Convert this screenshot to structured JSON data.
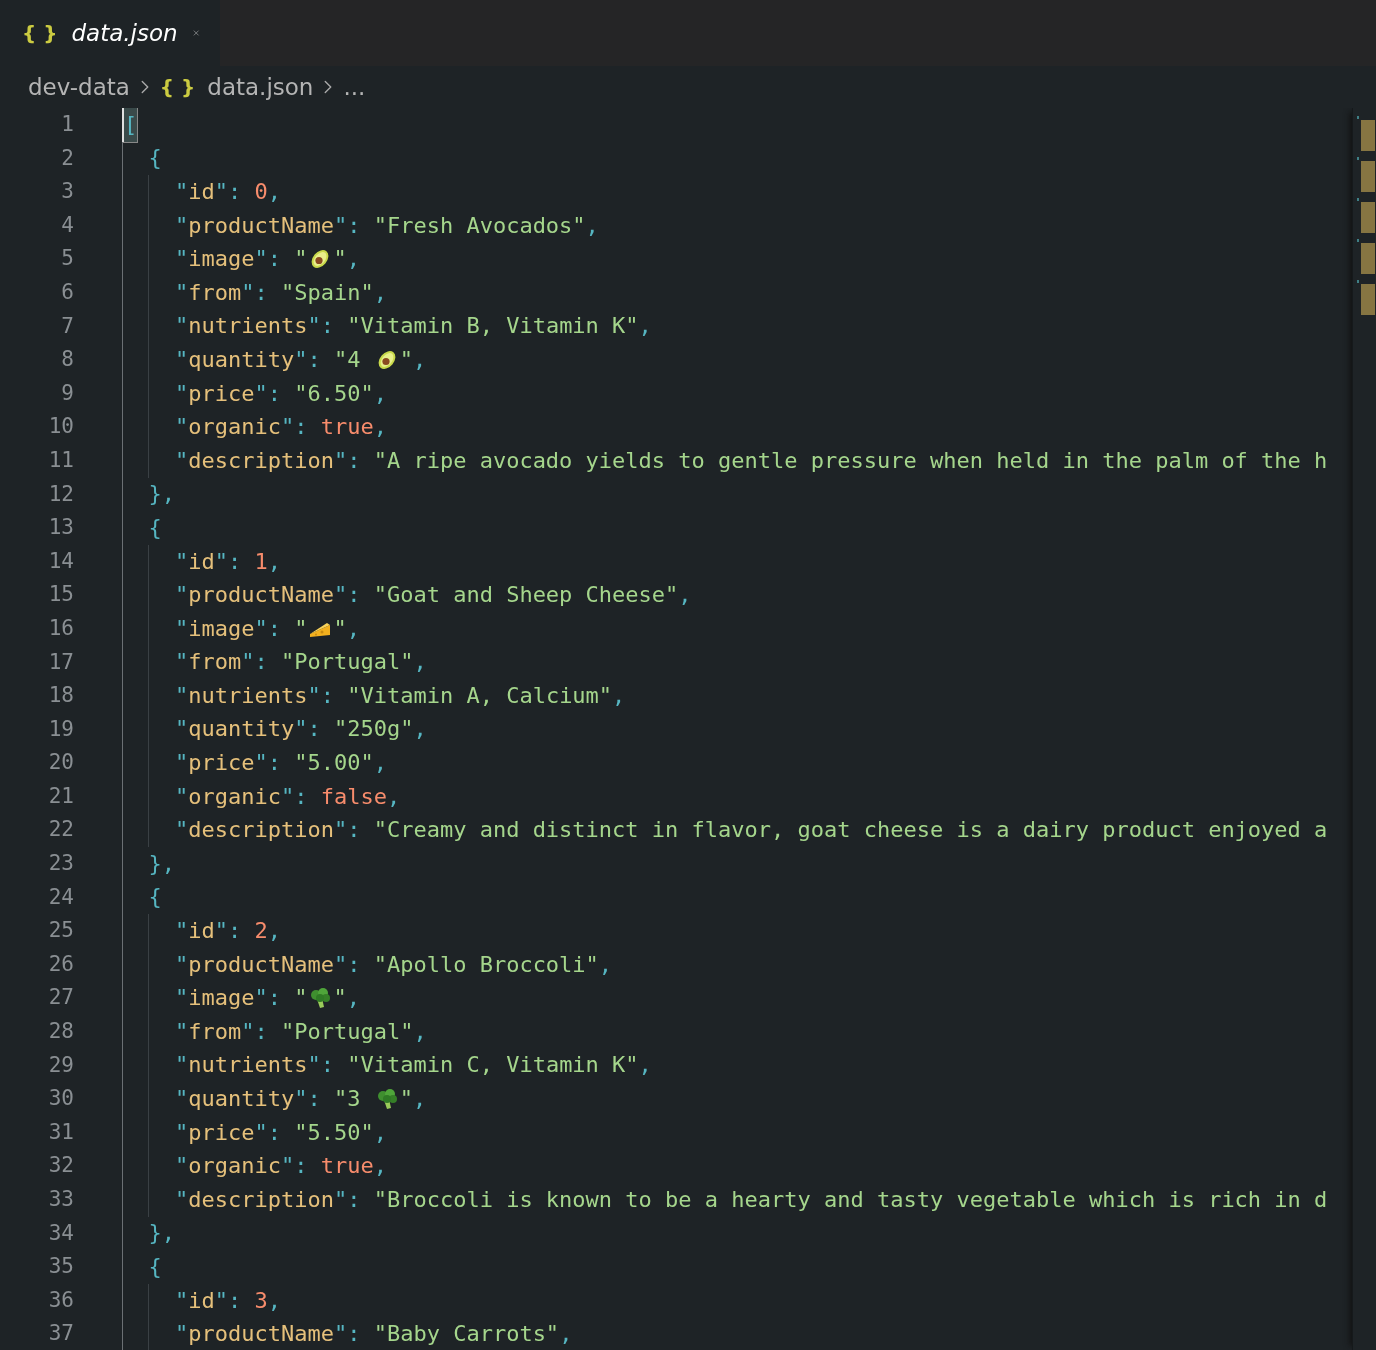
{
  "tabs": [
    {
      "icon": "{ }",
      "label": "data.json",
      "selected": true
    }
  ],
  "breadcrumbs": [
    {
      "text": "dev-data"
    },
    {
      "icon": "{ }",
      "text": "data.json"
    },
    {
      "text": "..."
    }
  ],
  "lines": [
    {
      "n": "1",
      "tokens": [
        {
          "kind": "bracket",
          "text": "["
        }
      ]
    },
    {
      "n": "2",
      "tokens": [
        {
          "kind": "punct",
          "text": "  {"
        }
      ]
    },
    {
      "n": "3",
      "tokens": [
        {
          "kind": "punct",
          "text": "    \""
        },
        {
          "kind": "key",
          "text": "id"
        },
        {
          "kind": "punct",
          "text": "\": "
        },
        {
          "kind": "literal",
          "text": "0"
        },
        {
          "kind": "punct",
          "text": ","
        }
      ]
    },
    {
      "n": "4",
      "tokens": [
        {
          "kind": "punct",
          "text": "    \""
        },
        {
          "kind": "key",
          "text": "productName"
        },
        {
          "kind": "punct",
          "text": "\": "
        },
        {
          "kind": "string",
          "text": "\"Fresh Avocados\""
        },
        {
          "kind": "punct",
          "text": ","
        }
      ]
    },
    {
      "n": "5",
      "tokens": [
        {
          "kind": "punct",
          "text": "    \""
        },
        {
          "kind": "key",
          "text": "image"
        },
        {
          "kind": "punct",
          "text": "\": "
        },
        {
          "kind": "string",
          "text": "\""
        },
        {
          "kind": "avocado"
        },
        {
          "kind": "string",
          "text": "\""
        },
        {
          "kind": "punct",
          "text": ","
        }
      ]
    },
    {
      "n": "6",
      "tokens": [
        {
          "kind": "punct",
          "text": "    \""
        },
        {
          "kind": "key",
          "text": "from"
        },
        {
          "kind": "punct",
          "text": "\": "
        },
        {
          "kind": "string",
          "text": "\"Spain\""
        },
        {
          "kind": "punct",
          "text": ","
        }
      ]
    },
    {
      "n": "7",
      "tokens": [
        {
          "kind": "punct",
          "text": "    \""
        },
        {
          "kind": "key",
          "text": "nutrients"
        },
        {
          "kind": "punct",
          "text": "\": "
        },
        {
          "kind": "string",
          "text": "\"Vitamin B, Vitamin K\""
        },
        {
          "kind": "punct",
          "text": ","
        }
      ]
    },
    {
      "n": "8",
      "tokens": [
        {
          "kind": "punct",
          "text": "    \""
        },
        {
          "kind": "key",
          "text": "quantity"
        },
        {
          "kind": "punct",
          "text": "\": "
        },
        {
          "kind": "string",
          "text": "\"4 "
        },
        {
          "kind": "avocado"
        },
        {
          "kind": "string",
          "text": "\""
        },
        {
          "kind": "punct",
          "text": ","
        }
      ]
    },
    {
      "n": "9",
      "tokens": [
        {
          "kind": "punct",
          "text": "    \""
        },
        {
          "kind": "key",
          "text": "price"
        },
        {
          "kind": "punct",
          "text": "\": "
        },
        {
          "kind": "string",
          "text": "\"6.50\""
        },
        {
          "kind": "punct",
          "text": ","
        }
      ]
    },
    {
      "n": "10",
      "tokens": [
        {
          "kind": "punct",
          "text": "    \""
        },
        {
          "kind": "key",
          "text": "organic"
        },
        {
          "kind": "punct",
          "text": "\": "
        },
        {
          "kind": "literal",
          "text": "true"
        },
        {
          "kind": "punct",
          "text": ","
        }
      ]
    },
    {
      "n": "11",
      "tokens": [
        {
          "kind": "punct",
          "text": "    \""
        },
        {
          "kind": "key",
          "text": "description"
        },
        {
          "kind": "punct",
          "text": "\": "
        },
        {
          "kind": "string",
          "text": "\"A ripe avocado yields to gentle pressure when held in the palm of the h"
        }
      ]
    },
    {
      "n": "12",
      "tokens": [
        {
          "kind": "punct",
          "text": "  },"
        }
      ]
    },
    {
      "n": "13",
      "tokens": [
        {
          "kind": "punct",
          "text": "  {"
        }
      ]
    },
    {
      "n": "14",
      "tokens": [
        {
          "kind": "punct",
          "text": "    \""
        },
        {
          "kind": "key",
          "text": "id"
        },
        {
          "kind": "punct",
          "text": "\": "
        },
        {
          "kind": "literal",
          "text": "1"
        },
        {
          "kind": "punct",
          "text": ","
        }
      ]
    },
    {
      "n": "15",
      "tokens": [
        {
          "kind": "punct",
          "text": "    \""
        },
        {
          "kind": "key",
          "text": "productName"
        },
        {
          "kind": "punct",
          "text": "\": "
        },
        {
          "kind": "string",
          "text": "\"Goat and Sheep Cheese\""
        },
        {
          "kind": "punct",
          "text": ","
        }
      ]
    },
    {
      "n": "16",
      "tokens": [
        {
          "kind": "punct",
          "text": "    \""
        },
        {
          "kind": "key",
          "text": "image"
        },
        {
          "kind": "punct",
          "text": "\": "
        },
        {
          "kind": "string",
          "text": "\""
        },
        {
          "kind": "cheese"
        },
        {
          "kind": "string",
          "text": "\""
        },
        {
          "kind": "punct",
          "text": ","
        }
      ]
    },
    {
      "n": "17",
      "tokens": [
        {
          "kind": "punct",
          "text": "    \""
        },
        {
          "kind": "key",
          "text": "from"
        },
        {
          "kind": "punct",
          "text": "\": "
        },
        {
          "kind": "string",
          "text": "\"Portugal\""
        },
        {
          "kind": "punct",
          "text": ","
        }
      ]
    },
    {
      "n": "18",
      "tokens": [
        {
          "kind": "punct",
          "text": "    \""
        },
        {
          "kind": "key",
          "text": "nutrients"
        },
        {
          "kind": "punct",
          "text": "\": "
        },
        {
          "kind": "string",
          "text": "\"Vitamin A, Calcium\""
        },
        {
          "kind": "punct",
          "text": ","
        }
      ]
    },
    {
      "n": "19",
      "tokens": [
        {
          "kind": "punct",
          "text": "    \""
        },
        {
          "kind": "key",
          "text": "quantity"
        },
        {
          "kind": "punct",
          "text": "\": "
        },
        {
          "kind": "string",
          "text": "\"250g\""
        },
        {
          "kind": "punct",
          "text": ","
        }
      ]
    },
    {
      "n": "20",
      "tokens": [
        {
          "kind": "punct",
          "text": "    \""
        },
        {
          "kind": "key",
          "text": "price"
        },
        {
          "kind": "punct",
          "text": "\": "
        },
        {
          "kind": "string",
          "text": "\"5.00\""
        },
        {
          "kind": "punct",
          "text": ","
        }
      ]
    },
    {
      "n": "21",
      "tokens": [
        {
          "kind": "punct",
          "text": "    \""
        },
        {
          "kind": "key",
          "text": "organic"
        },
        {
          "kind": "punct",
          "text": "\": "
        },
        {
          "kind": "literal",
          "text": "false"
        },
        {
          "kind": "punct",
          "text": ","
        }
      ]
    },
    {
      "n": "22",
      "tokens": [
        {
          "kind": "punct",
          "text": "    \""
        },
        {
          "kind": "key",
          "text": "description"
        },
        {
          "kind": "punct",
          "text": "\": "
        },
        {
          "kind": "string",
          "text": "\"Creamy and distinct in flavor, goat cheese is a dairy product enjoyed a"
        }
      ]
    },
    {
      "n": "23",
      "tokens": [
        {
          "kind": "punct",
          "text": "  },"
        }
      ]
    },
    {
      "n": "24",
      "tokens": [
        {
          "kind": "punct",
          "text": "  {"
        }
      ]
    },
    {
      "n": "25",
      "tokens": [
        {
          "kind": "punct",
          "text": "    \""
        },
        {
          "kind": "key",
          "text": "id"
        },
        {
          "kind": "punct",
          "text": "\": "
        },
        {
          "kind": "literal",
          "text": "2"
        },
        {
          "kind": "punct",
          "text": ","
        }
      ]
    },
    {
      "n": "26",
      "tokens": [
        {
          "kind": "punct",
          "text": "    \""
        },
        {
          "kind": "key",
          "text": "productName"
        },
        {
          "kind": "punct",
          "text": "\": "
        },
        {
          "kind": "string",
          "text": "\"Apollo Broccoli\""
        },
        {
          "kind": "punct",
          "text": ","
        }
      ]
    },
    {
      "n": "27",
      "tokens": [
        {
          "kind": "punct",
          "text": "    \""
        },
        {
          "kind": "key",
          "text": "image"
        },
        {
          "kind": "punct",
          "text": "\": "
        },
        {
          "kind": "string",
          "text": "\""
        },
        {
          "kind": "broccoli"
        },
        {
          "kind": "string",
          "text": "\""
        },
        {
          "kind": "punct",
          "text": ","
        }
      ]
    },
    {
      "n": "28",
      "tokens": [
        {
          "kind": "punct",
          "text": "    \""
        },
        {
          "kind": "key",
          "text": "from"
        },
        {
          "kind": "punct",
          "text": "\": "
        },
        {
          "kind": "string",
          "text": "\"Portugal\""
        },
        {
          "kind": "punct",
          "text": ","
        }
      ]
    },
    {
      "n": "29",
      "tokens": [
        {
          "kind": "punct",
          "text": "    \""
        },
        {
          "kind": "key",
          "text": "nutrients"
        },
        {
          "kind": "punct",
          "text": "\": "
        },
        {
          "kind": "string",
          "text": "\"Vitamin C, Vitamin K\""
        },
        {
          "kind": "punct",
          "text": ","
        }
      ]
    },
    {
      "n": "30",
      "tokens": [
        {
          "kind": "punct",
          "text": "    \""
        },
        {
          "kind": "key",
          "text": "quantity"
        },
        {
          "kind": "punct",
          "text": "\": "
        },
        {
          "kind": "string",
          "text": "\"3 "
        },
        {
          "kind": "broccoli"
        },
        {
          "kind": "string",
          "text": "\""
        },
        {
          "kind": "punct",
          "text": ","
        }
      ]
    },
    {
      "n": "31",
      "tokens": [
        {
          "kind": "punct",
          "text": "    \""
        },
        {
          "kind": "key",
          "text": "price"
        },
        {
          "kind": "punct",
          "text": "\": "
        },
        {
          "kind": "string",
          "text": "\"5.50\""
        },
        {
          "kind": "punct",
          "text": ","
        }
      ]
    },
    {
      "n": "32",
      "tokens": [
        {
          "kind": "punct",
          "text": "    \""
        },
        {
          "kind": "key",
          "text": "organic"
        },
        {
          "kind": "punct",
          "text": "\": "
        },
        {
          "kind": "literal",
          "text": "true"
        },
        {
          "kind": "punct",
          "text": ","
        }
      ]
    },
    {
      "n": "33",
      "tokens": [
        {
          "kind": "punct",
          "text": "    \""
        },
        {
          "kind": "key",
          "text": "description"
        },
        {
          "kind": "punct",
          "text": "\": "
        },
        {
          "kind": "string",
          "text": "\"Broccoli is known to be a hearty and tasty vegetable which is rich in d"
        }
      ]
    },
    {
      "n": "34",
      "tokens": [
        {
          "kind": "punct",
          "text": "  },"
        }
      ]
    },
    {
      "n": "35",
      "tokens": [
        {
          "kind": "punct",
          "text": "  {"
        }
      ]
    },
    {
      "n": "36",
      "tokens": [
        {
          "kind": "punct",
          "text": "    \""
        },
        {
          "kind": "key",
          "text": "id"
        },
        {
          "kind": "punct",
          "text": "\": "
        },
        {
          "kind": "literal",
          "text": "3"
        },
        {
          "kind": "punct",
          "text": ","
        }
      ]
    },
    {
      "n": "37",
      "tokens": [
        {
          "kind": "punct",
          "text": "    \""
        },
        {
          "kind": "key",
          "text": "productName"
        },
        {
          "kind": "punct",
          "text": "\": "
        },
        {
          "kind": "string",
          "text": "\"Baby Carrots\""
        },
        {
          "kind": "punct",
          "text": ","
        }
      ]
    }
  ]
}
